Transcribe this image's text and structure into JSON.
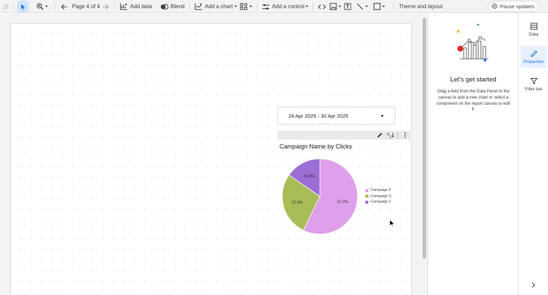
{
  "toolbar": {
    "page_indicator": "Page 4 of 4",
    "add_data": "Add data",
    "blend": "Blend",
    "add_chart": "Add a chart",
    "add_control": "Add a control",
    "theme_layout": "Theme and layout",
    "pause_updates": "Pause updates"
  },
  "date_control": {
    "value": "24 Apr 2025 - 30 Apr 2025"
  },
  "chart": {
    "title": "Campaign Name by Clicks"
  },
  "chart_data": {
    "type": "pie",
    "title": "Campaign Name by Clicks",
    "categories": [
      "Campaign 2",
      "Campaign 3",
      "Campaign 1"
    ],
    "values": [
      57.2,
      27.5,
      15.3
    ],
    "data_labels": [
      "57.2%",
      "27.5%",
      "15.3%"
    ],
    "colors": [
      "#dea0ea",
      "#a8bd58",
      "#9c6ed5"
    ],
    "legend_placement": "right"
  },
  "right_panel": {
    "title": "Let's get started",
    "description": "Drag a field from the Data Panel to the canvas to add a new chart or select a component on the report canvas to edit it."
  },
  "side_tabs": [
    {
      "label": "Data",
      "icon": "table-icon"
    },
    {
      "label": "Properties",
      "icon": "pencil-icon"
    },
    {
      "label": "Filter bar",
      "icon": "filter-icon"
    }
  ],
  "colors": {
    "accent": "#1a73e8",
    "toolbar_bg": "#f1f3f4"
  }
}
